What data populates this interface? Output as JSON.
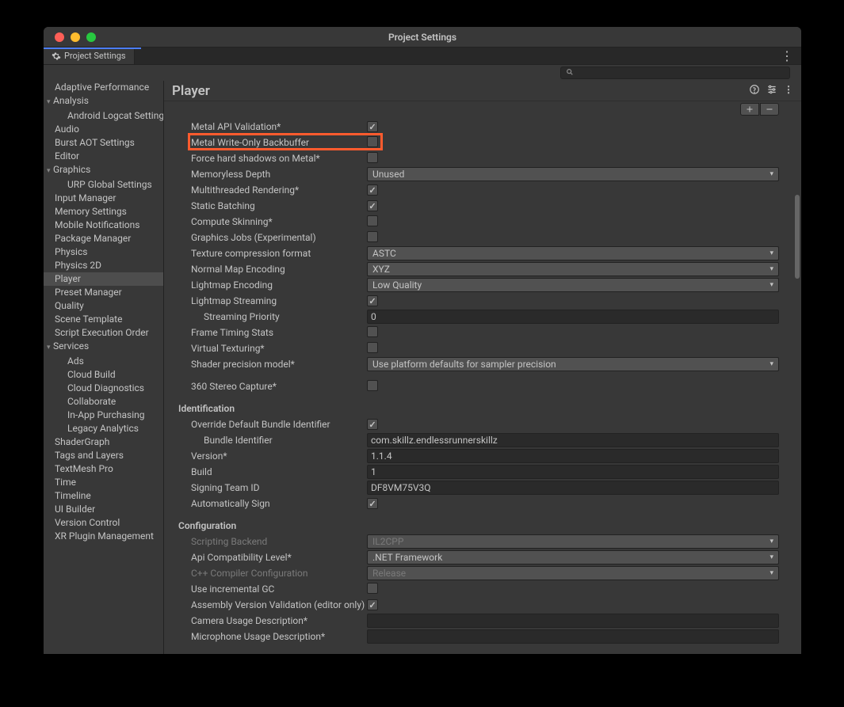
{
  "window": {
    "title": "Project Settings"
  },
  "tab": {
    "label": "Project Settings"
  },
  "sidebar": {
    "items": [
      {
        "label": "Adaptive Performance",
        "child": false,
        "arrow": ""
      },
      {
        "label": "Analysis",
        "child": false,
        "arrow": "▾"
      },
      {
        "label": "Android Logcat Settings",
        "child": true,
        "arrow": ""
      },
      {
        "label": "Audio",
        "child": false,
        "arrow": ""
      },
      {
        "label": "Burst AOT Settings",
        "child": false,
        "arrow": ""
      },
      {
        "label": "Editor",
        "child": false,
        "arrow": ""
      },
      {
        "label": "Graphics",
        "child": false,
        "arrow": "▾"
      },
      {
        "label": "URP Global Settings",
        "child": true,
        "arrow": ""
      },
      {
        "label": "Input Manager",
        "child": false,
        "arrow": ""
      },
      {
        "label": "Memory Settings",
        "child": false,
        "arrow": ""
      },
      {
        "label": "Mobile Notifications",
        "child": false,
        "arrow": ""
      },
      {
        "label": "Package Manager",
        "child": false,
        "arrow": ""
      },
      {
        "label": "Physics",
        "child": false,
        "arrow": ""
      },
      {
        "label": "Physics 2D",
        "child": false,
        "arrow": ""
      },
      {
        "label": "Player",
        "child": false,
        "arrow": "",
        "selected": true
      },
      {
        "label": "Preset Manager",
        "child": false,
        "arrow": ""
      },
      {
        "label": "Quality",
        "child": false,
        "arrow": ""
      },
      {
        "label": "Scene Template",
        "child": false,
        "arrow": ""
      },
      {
        "label": "Script Execution Order",
        "child": false,
        "arrow": ""
      },
      {
        "label": "Services",
        "child": false,
        "arrow": "▾"
      },
      {
        "label": "Ads",
        "child": true,
        "arrow": ""
      },
      {
        "label": "Cloud Build",
        "child": true,
        "arrow": ""
      },
      {
        "label": "Cloud Diagnostics",
        "child": true,
        "arrow": ""
      },
      {
        "label": "Collaborate",
        "child": true,
        "arrow": ""
      },
      {
        "label": "In-App Purchasing",
        "child": true,
        "arrow": ""
      },
      {
        "label": "Legacy Analytics",
        "child": true,
        "arrow": ""
      },
      {
        "label": "ShaderGraph",
        "child": false,
        "arrow": ""
      },
      {
        "label": "Tags and Layers",
        "child": false,
        "arrow": ""
      },
      {
        "label": "TextMesh Pro",
        "child": false,
        "arrow": ""
      },
      {
        "label": "Time",
        "child": false,
        "arrow": ""
      },
      {
        "label": "Timeline",
        "child": false,
        "arrow": ""
      },
      {
        "label": "UI Builder",
        "child": false,
        "arrow": ""
      },
      {
        "label": "Version Control",
        "child": false,
        "arrow": ""
      },
      {
        "label": "XR Plugin Management",
        "child": false,
        "arrow": ""
      }
    ]
  },
  "main": {
    "title": "Player",
    "rows": [
      {
        "type": "checkbox",
        "label": "Metal API Validation*",
        "checked": true
      },
      {
        "type": "checkbox",
        "label": "Metal Write-Only Backbuffer",
        "checked": false,
        "highlight": true
      },
      {
        "type": "checkbox",
        "label": "Force hard shadows on Metal*",
        "checked": false
      },
      {
        "type": "dropdown",
        "label": "Memoryless Depth",
        "value": "Unused"
      },
      {
        "type": "checkbox",
        "label": "Multithreaded Rendering*",
        "checked": true
      },
      {
        "type": "checkbox",
        "label": "Static Batching",
        "checked": true
      },
      {
        "type": "checkbox",
        "label": "Compute Skinning*",
        "checked": false
      },
      {
        "type": "checkbox",
        "label": "Graphics Jobs (Experimental)",
        "checked": false
      },
      {
        "type": "dropdown",
        "label": "Texture compression format",
        "value": "ASTC"
      },
      {
        "type": "dropdown",
        "label": "Normal Map Encoding",
        "value": "XYZ"
      },
      {
        "type": "dropdown",
        "label": "Lightmap Encoding",
        "value": "Low Quality"
      },
      {
        "type": "checkbox",
        "label": "Lightmap Streaming",
        "checked": true
      },
      {
        "type": "text",
        "label": "Streaming Priority",
        "value": "0",
        "indent": true
      },
      {
        "type": "checkbox",
        "label": "Frame Timing Stats",
        "checked": false
      },
      {
        "type": "checkbox",
        "label": "Virtual Texturing*",
        "checked": false
      },
      {
        "type": "dropdown",
        "label": "Shader precision model*",
        "value": "Use platform defaults for sampler precision"
      },
      {
        "type": "spacer"
      },
      {
        "type": "checkbox",
        "label": "360 Stereo Capture*",
        "checked": false
      },
      {
        "type": "spacer"
      },
      {
        "type": "section",
        "label": "Identification"
      },
      {
        "type": "checkbox",
        "label": "Override Default Bundle Identifier",
        "checked": true
      },
      {
        "type": "text",
        "label": "Bundle Identifier",
        "value": "com.skillz.endlessrunnerskillz",
        "indent": true
      },
      {
        "type": "text",
        "label": "Version*",
        "value": "1.1.4"
      },
      {
        "type": "text",
        "label": "Build",
        "value": "1"
      },
      {
        "type": "text",
        "label": "Signing Team ID",
        "value": "DF8VM75V3Q"
      },
      {
        "type": "checkbox",
        "label": "Automatically Sign",
        "checked": true
      },
      {
        "type": "spacer"
      },
      {
        "type": "section",
        "label": "Configuration"
      },
      {
        "type": "dropdown",
        "label": "Scripting Backend",
        "value": "IL2CPP",
        "dim": true
      },
      {
        "type": "dropdown",
        "label": "Api Compatibility Level*",
        "value": ".NET Framework"
      },
      {
        "type": "dropdown",
        "label": "C++ Compiler Configuration",
        "value": "Release",
        "dim": true
      },
      {
        "type": "checkbox",
        "label": "Use incremental GC",
        "checked": false
      },
      {
        "type": "checkbox",
        "label": "Assembly Version Validation (editor only)",
        "checked": true
      },
      {
        "type": "text",
        "label": "Camera Usage Description*",
        "value": ""
      },
      {
        "type": "text",
        "label": "Microphone Usage Description*",
        "value": ""
      }
    ]
  }
}
